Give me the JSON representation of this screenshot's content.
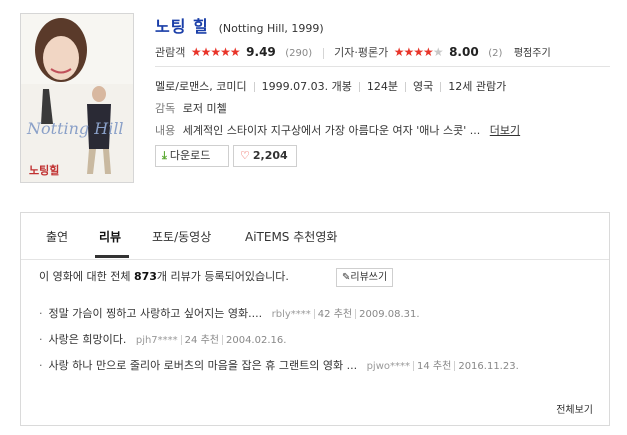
{
  "movie": {
    "title": "노팅 힐",
    "original_title": "(Notting Hill, 1999)",
    "poster_title_text": "Notting Hill",
    "poster_korean_text": "노팅힐"
  },
  "ratings": {
    "audience_label": "관람객",
    "audience_score": "9.49",
    "audience_count": "(290)",
    "audience_stars": 5,
    "critic_label": "기자·평론가",
    "critic_score": "8.00",
    "critic_count": "(2)",
    "critic_stars": 4,
    "rate_link": "평점주기"
  },
  "info": {
    "genre": "멜로/로맨스, 코미디",
    "release": "1999.07.03. 개봉",
    "runtime": "124분",
    "country": "영국",
    "rating": "12세 관람가",
    "director_label": "감독",
    "director": "로저 미첼",
    "plot_label": "내용",
    "plot": "세계적인 스타이자 지구상에서 가장 아름다운 여자 '애나 스콧' ...",
    "more_link": "더보기"
  },
  "buttons": {
    "download": "다운로드",
    "like_count": "2,204"
  },
  "tabs": [
    {
      "label": "출연"
    },
    {
      "label": "리뷰"
    },
    {
      "label": "포토/동영상"
    },
    {
      "label": "AiTEMS 추천영화"
    }
  ],
  "reviews_section": {
    "summary_prefix": "이 영화에 대한 전체 ",
    "total": "873",
    "summary_suffix": "개 리뷰가 등록되어있습니다.",
    "write_button": "리뷰쓰기",
    "view_all": "전체보기",
    "items": [
      {
        "text": "정말 가슴이 찡하고 사랑하고 싶어지는 영화....",
        "user": "rbly****",
        "recommend": "42 추천",
        "date": "2009.08.31."
      },
      {
        "text": "사랑은 희망이다.",
        "user": "pjh7****",
        "recommend": "24 추천",
        "date": "2004.02.16."
      },
      {
        "text": "사랑 하나 만으로 줄리아 로버츠의 마음을 잡은 휴 그랜트의 영화 ...",
        "user": "pjwo****",
        "recommend": "14 추천",
        "date": "2016.11.23."
      }
    ]
  },
  "colors": {
    "title_blue": "#1a3ea8",
    "star_red": "#e8352a",
    "download_green": "#5aa831"
  }
}
